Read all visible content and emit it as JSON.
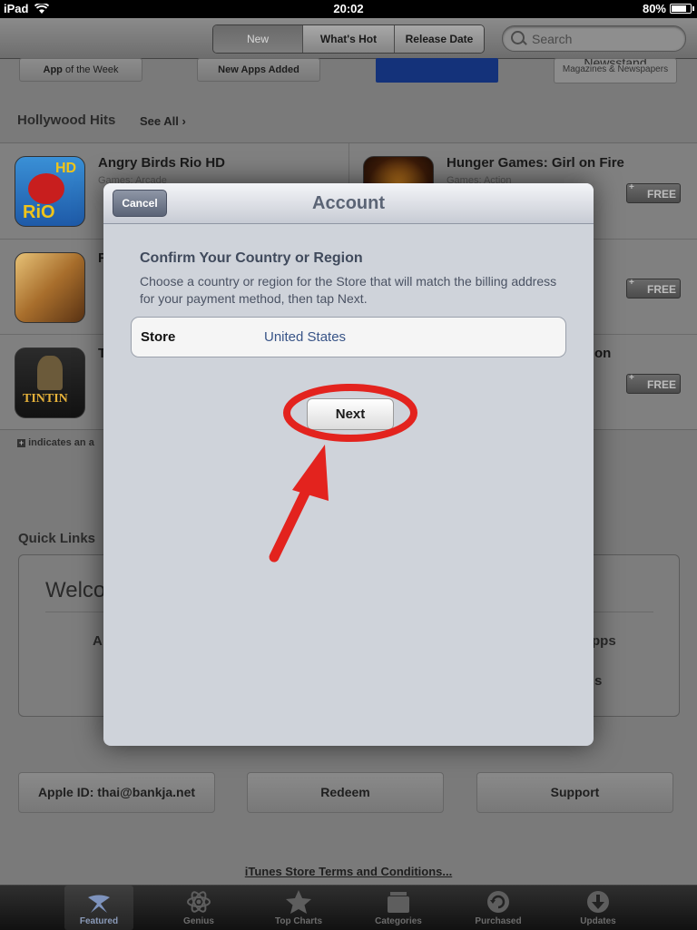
{
  "status_bar": {
    "device": "iPad",
    "time": "20:02",
    "battery": "80%",
    "battery_fraction": 0.8
  },
  "toolbar": {
    "segments": [
      {
        "label": "New",
        "selected": true
      },
      {
        "label": "What's Hot",
        "selected": false
      },
      {
        "label": "Release Date",
        "selected": false
      }
    ],
    "search_placeholder": "Search"
  },
  "banners": {
    "app_of_week_a": "App",
    "app_of_week_b": "of the Week",
    "new_apps": "New Apps Added",
    "newsstand_title": "Newsstand",
    "newsstand_sub": "Magazines & Newspapers"
  },
  "hollywood": {
    "title": "Hollywood Hits",
    "see_all": "See All",
    "apps": [
      {
        "name": "Angry Birds Rio HD",
        "category": "Games: Arcade"
      },
      {
        "name": "Hunger Games: Girl on Fire",
        "category": "Games: Action",
        "price": "FREE"
      },
      {
        "name": "F",
        "category": "",
        "price": "FREE"
      },
      {
        "name": "T",
        "category": "",
        "name_right": "on",
        "price": "FREE"
      }
    ],
    "footnote": "indicates an a"
  },
  "quick_links": {
    "title": "Quick Links",
    "welcome": "Welco",
    "left_a": "A",
    "right_1": "pps",
    "right_2": "s"
  },
  "bottom_buttons": {
    "apple_id": "Apple ID: thai@bankja.net",
    "redeem": "Redeem",
    "support": "Support"
  },
  "terms": "iTunes Store Terms and Conditions...",
  "tabs": [
    {
      "label": "Featured",
      "icon": "featured-icon",
      "active": true
    },
    {
      "label": "Genius",
      "icon": "atom-icon",
      "active": false
    },
    {
      "label": "Top Charts",
      "icon": "star-icon",
      "active": false
    },
    {
      "label": "Categories",
      "icon": "box-icon",
      "active": false
    },
    {
      "label": "Purchased",
      "icon": "purchased-icon",
      "active": false
    },
    {
      "label": "Updates",
      "icon": "download-icon",
      "active": false
    }
  ],
  "modal": {
    "title": "Account",
    "cancel": "Cancel",
    "heading": "Confirm Your Country or Region",
    "description": "Choose a country or region for the Store that will match the billing address for your payment method, then tap Next.",
    "store_label": "Store",
    "store_value": "United States",
    "next": "Next"
  },
  "colors": {
    "annotation": "#e3231e",
    "modal_title": "#5b6475",
    "link_blue": "#385487"
  }
}
